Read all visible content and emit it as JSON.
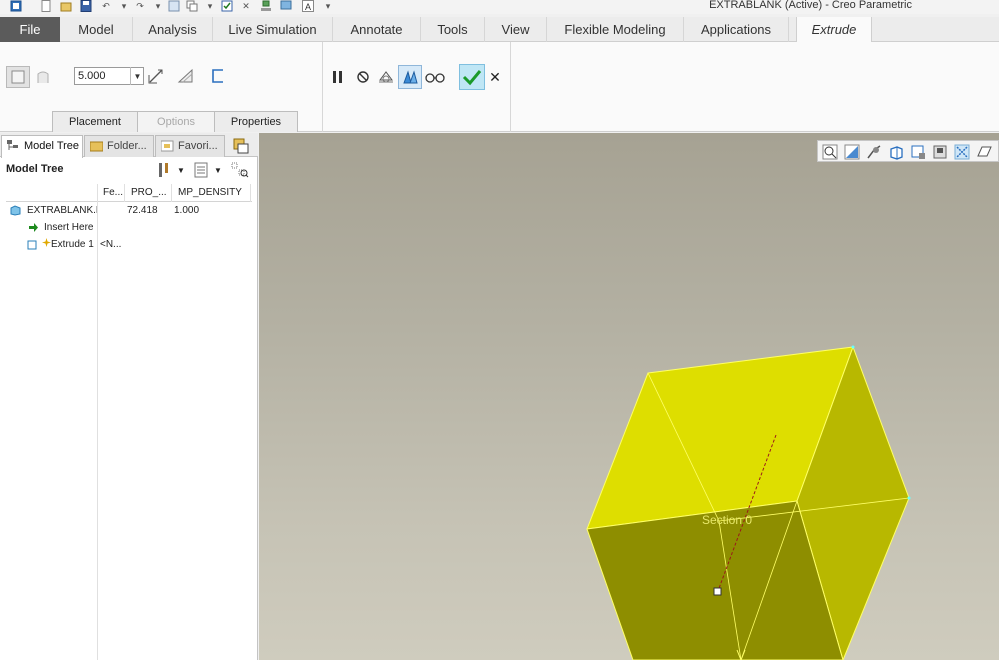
{
  "window": {
    "title": "EXTRABLANK (Active) - Creo Parametric"
  },
  "ribbon": {
    "tabs": [
      {
        "label": "File"
      },
      {
        "label": "Model"
      },
      {
        "label": "Analysis"
      },
      {
        "label": "Live Simulation"
      },
      {
        "label": "Annotate"
      },
      {
        "label": "Tools"
      },
      {
        "label": "View"
      },
      {
        "label": "Flexible Modeling"
      },
      {
        "label": "Applications"
      },
      {
        "label": "Extrude"
      }
    ],
    "active_tab": "Extrude"
  },
  "dashboard": {
    "depth_value": "5.000",
    "subtabs": [
      {
        "label": "Placement",
        "enabled": true
      },
      {
        "label": "Options",
        "enabled": false
      },
      {
        "label": "Properties",
        "enabled": true
      }
    ],
    "colors": {
      "confirm": "#1a9a2a",
      "confirm_bg": "#bfe6f5"
    }
  },
  "navigator": {
    "tabs": [
      {
        "label": "Model Tree"
      },
      {
        "label": "Folder..."
      },
      {
        "label": "Favori..."
      }
    ],
    "tree_title": "Model Tree",
    "columns": [
      "Fe...",
      "PRO_...",
      "MP_DENSITY"
    ],
    "rows": [
      {
        "name": "EXTRABLANK.PRT",
        "col1": "",
        "col2": "72.418",
        "col3": "1.000",
        "icon": "part-icon"
      },
      {
        "name": "Insert Here",
        "col1": "",
        "col2": "",
        "col3": "",
        "icon": "insert-arrow-icon"
      },
      {
        "name": "Extrude 1",
        "col1": "<N...",
        "col2": "",
        "col3": "",
        "icon": "extrude-icon"
      }
    ]
  },
  "graphics": {
    "section_label": "Section 0",
    "colors": {
      "top_face": "#dede00",
      "right_face": "#b8b800",
      "front_face": "#8e8e00",
      "edge": "#ffff66"
    }
  }
}
